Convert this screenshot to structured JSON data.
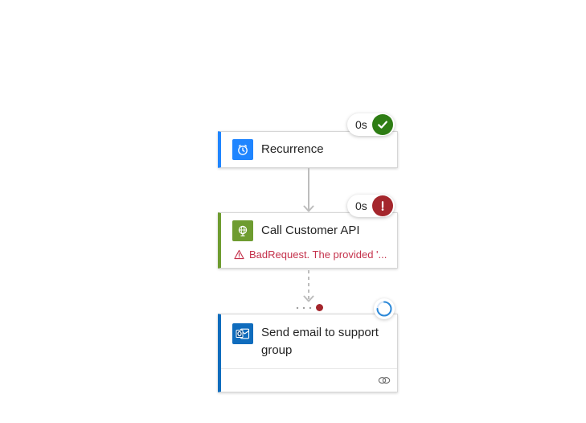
{
  "steps": {
    "recurrence": {
      "title": "Recurrence",
      "icon": "clock-icon",
      "duration": "0s",
      "status": "success",
      "accent": "#1f85ff"
    },
    "call_api": {
      "title": "Call Customer API",
      "icon": "globe-icon",
      "duration": "0s",
      "status": "failed",
      "error": "BadRequest. The provided '...",
      "accent": "#6e9c30"
    },
    "send_email": {
      "title_line1": "Send email to support",
      "title_line2": "group",
      "icon": "outlook-icon",
      "status": "running",
      "accent": "#0f6cbd"
    }
  },
  "colors": {
    "success": "#2e7d14",
    "error": "#a4262c",
    "error_text": "#c4314b",
    "connector": "#bdbdbd"
  }
}
